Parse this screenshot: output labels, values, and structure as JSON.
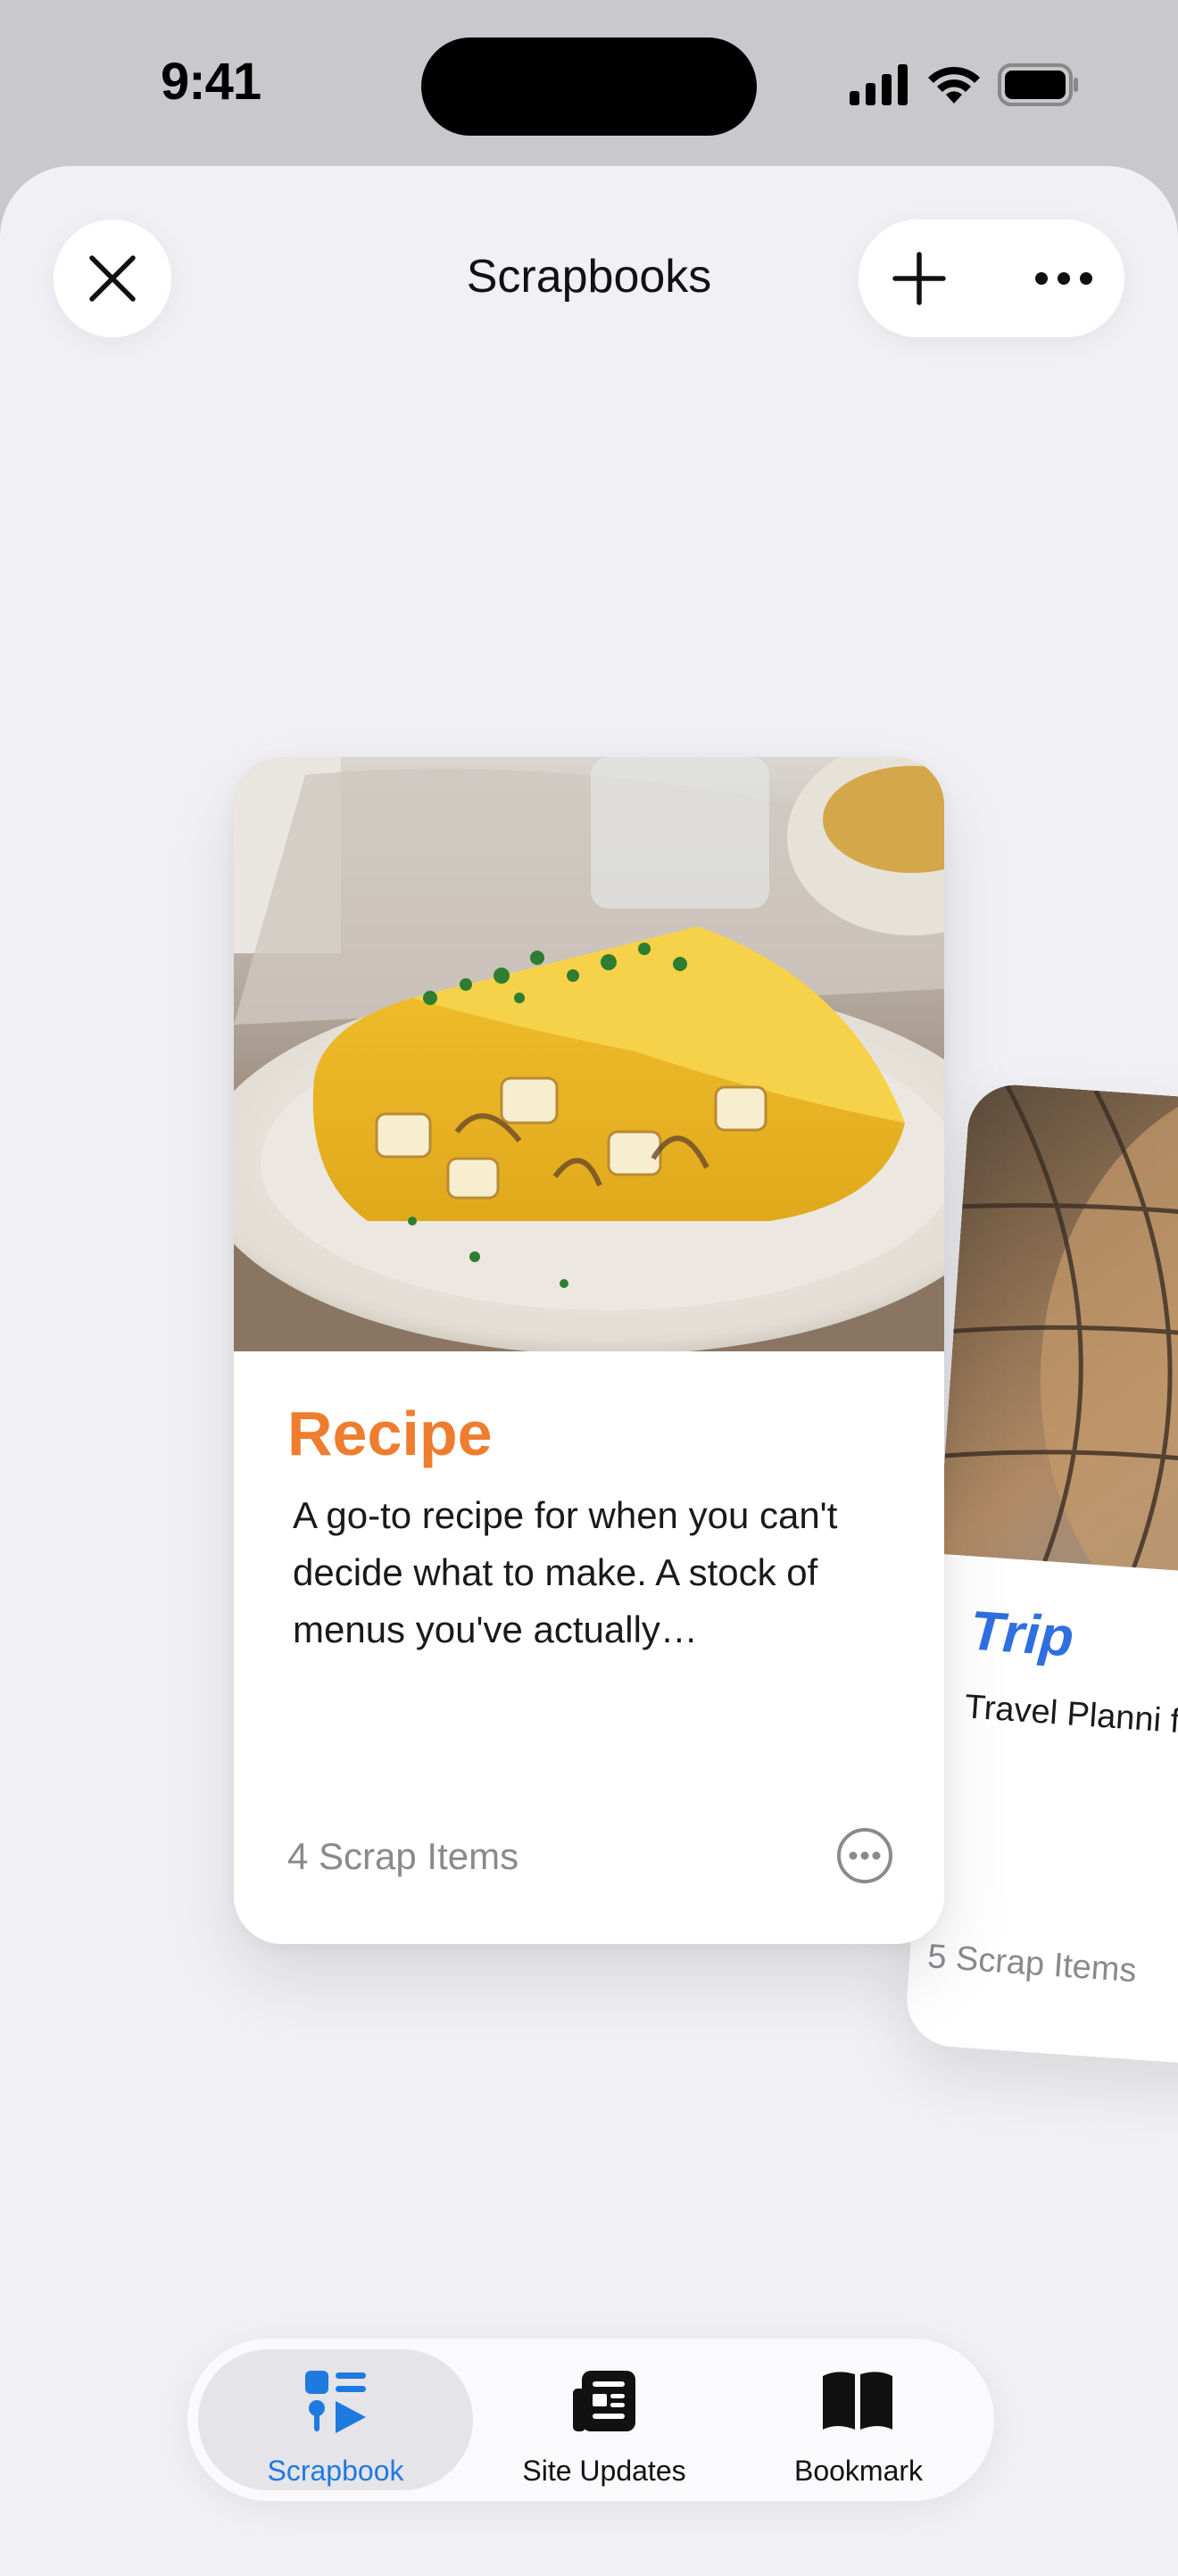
{
  "status_bar": {
    "time": "9:41",
    "icons": [
      "signal-icon",
      "wifi-icon",
      "battery-icon"
    ]
  },
  "header": {
    "title": "Scrapbooks",
    "close_icon": "close-icon",
    "add_icon": "plus-icon",
    "more_icon": "ellipsis-icon"
  },
  "cards": [
    {
      "title": "Recipe",
      "description": "A go-to recipe for when you can't decide what to make. A stock of menus you've actually…",
      "count": "4 Scrap Items",
      "accent": "#ee7d2e",
      "image": "potato omelette on a plate"
    },
    {
      "title": "Trip",
      "description": "Travel Planni for Sweden",
      "count": "5 Scrap Items",
      "accent": "#2f6fe0",
      "image": "glass dome architecture"
    }
  ],
  "tabs": [
    {
      "label": "Scrapbook",
      "icon": "scrapbook-icon",
      "selected": true
    },
    {
      "label": "Site Updates",
      "icon": "newspaper-icon",
      "selected": false
    },
    {
      "label": "Bookmark",
      "icon": "book-icon",
      "selected": false
    }
  ],
  "colors": {
    "active_tab": "#1f7ae0",
    "recipe_accent": "#ee7d2e",
    "trip_accent": "#2f6fe0",
    "background": "#f1f1f5"
  }
}
